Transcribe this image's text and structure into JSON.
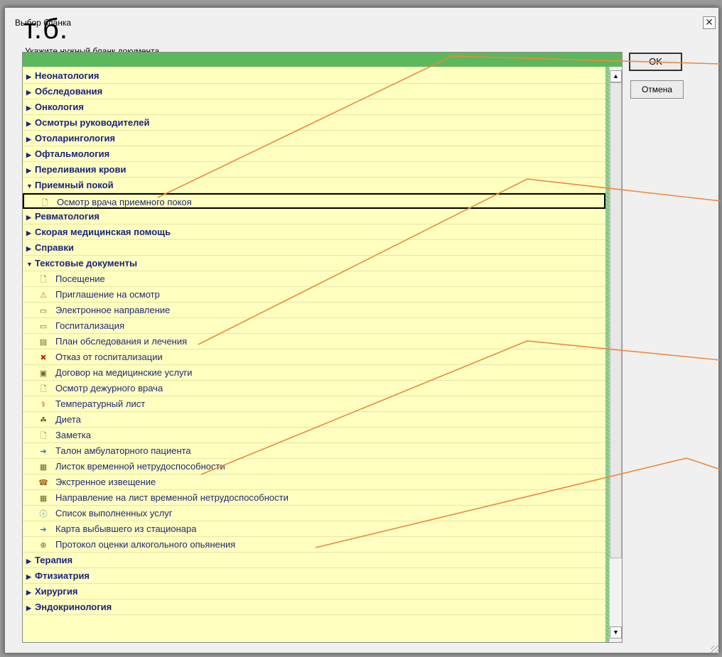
{
  "dialog": {
    "title": "Выбор бланка",
    "overlay_text": "т.б.",
    "close_glyph": "✕",
    "prompt": "Укажите нужный бланк документа"
  },
  "buttons": {
    "ok": "OK",
    "cancel": "Отмена"
  },
  "tree": [
    {
      "type": "category",
      "label": "Неонатология",
      "expanded": false
    },
    {
      "type": "category",
      "label": "Обследования",
      "expanded": false
    },
    {
      "type": "category",
      "label": "Онкология",
      "expanded": false
    },
    {
      "type": "category",
      "label": "Осмотры руководителей",
      "expanded": false
    },
    {
      "type": "category",
      "label": "Отоларингология",
      "expanded": false
    },
    {
      "type": "category",
      "label": "Офтальмология",
      "expanded": false
    },
    {
      "type": "category",
      "label": "Переливания крови",
      "expanded": false
    },
    {
      "type": "category",
      "label": "Приемный покой",
      "expanded": true
    },
    {
      "type": "item",
      "label": "Осмотр врача приемного покоя",
      "icon": "document-icon",
      "selected": true
    },
    {
      "type": "category",
      "label": "Ревматология",
      "expanded": false
    },
    {
      "type": "category",
      "label": "Скорая медицинская помощь",
      "expanded": false
    },
    {
      "type": "category",
      "label": "Справки",
      "expanded": false
    },
    {
      "type": "category",
      "label": "Текстовые документы",
      "expanded": true
    },
    {
      "type": "item",
      "label": "Посещение",
      "icon": "document-icon"
    },
    {
      "type": "item",
      "label": "Приглашение на  осмотр",
      "icon": "warning-icon"
    },
    {
      "type": "item",
      "label": "Электронное направление",
      "icon": "form-icon"
    },
    {
      "type": "item",
      "label": "Госпитализация",
      "icon": "form-icon"
    },
    {
      "type": "item",
      "label": "План обследования и лечения",
      "icon": "edit-form-icon"
    },
    {
      "type": "item",
      "label": "Отказ от госпитализации",
      "icon": "cross-icon"
    },
    {
      "type": "item",
      "label": "Договор на медицинские услуги",
      "icon": "contract-icon"
    },
    {
      "type": "item",
      "label": "Осмотр дежурного врача",
      "icon": "document-icon"
    },
    {
      "type": "item",
      "label": "Температурный лист",
      "icon": "thermometer-icon"
    },
    {
      "type": "item",
      "label": "Диета",
      "icon": "diet-icon"
    },
    {
      "type": "item",
      "label": "Заметка",
      "icon": "note-icon"
    },
    {
      "type": "item",
      "label": "Талон амбулаторного пациента",
      "icon": "arrow-right-icon"
    },
    {
      "type": "item",
      "label": "Листок временной нетрудоспособности",
      "icon": "calendar-icon"
    },
    {
      "type": "item",
      "label": "Экстренное извещение",
      "icon": "phone-icon"
    },
    {
      "type": "item",
      "label": "Направление на лист временной нетрудоспособности",
      "icon": "calendar-icon"
    },
    {
      "type": "item",
      "label": "Список выполненных услуг",
      "icon": "info-icon"
    },
    {
      "type": "item",
      "label": "Карта выбывшего из стационара",
      "icon": "arrow-right-icon"
    },
    {
      "type": "item",
      "label": "Протокол оценки алкогольного опьянения",
      "icon": "protocol-icon"
    },
    {
      "type": "category",
      "label": "Терапия",
      "expanded": false
    },
    {
      "type": "category",
      "label": "Фтизиатрия",
      "expanded": false
    },
    {
      "type": "category",
      "label": "Хирургия",
      "expanded": false
    },
    {
      "type": "category",
      "label": "Эндокринология",
      "expanded": false
    }
  ],
  "scrollbar": {
    "up_glyph": "▲",
    "down_glyph": "▼"
  },
  "colors": {
    "annotation_line": "#f0883c",
    "header_green": "#5cb85c",
    "row_bg": "#ffffc0",
    "tree_text": "#1a237e"
  }
}
